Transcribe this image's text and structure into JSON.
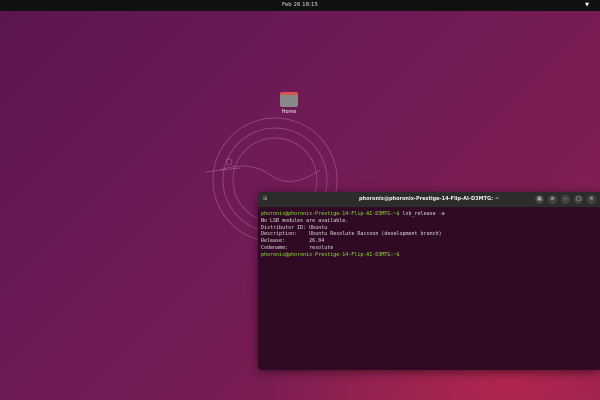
{
  "topbar": {
    "datetime": "Feb 26  18:15",
    "tray_icon": "network-icon"
  },
  "desktop": {
    "home_label": "Home"
  },
  "terminal": {
    "title": "phoronix@phoronix-Prestige-14-Flip-AI-D3MTG: ~",
    "prompt": "phoronix@phoronix-Prestige-14-Flip-AI-D3MTG:~$",
    "command": " lsb_release -a",
    "lines": [
      "No LSB modules are available.",
      "Distributor ID:\tUbuntu",
      "Description:\tUbuntu Resolute Raccoon (development branch)",
      "Release:\t26.04",
      "Codename:\tresolute"
    ],
    "prompt2": "phoronix@phoronix-Prestige-14-Flip-AI-D3MTG:~$"
  }
}
